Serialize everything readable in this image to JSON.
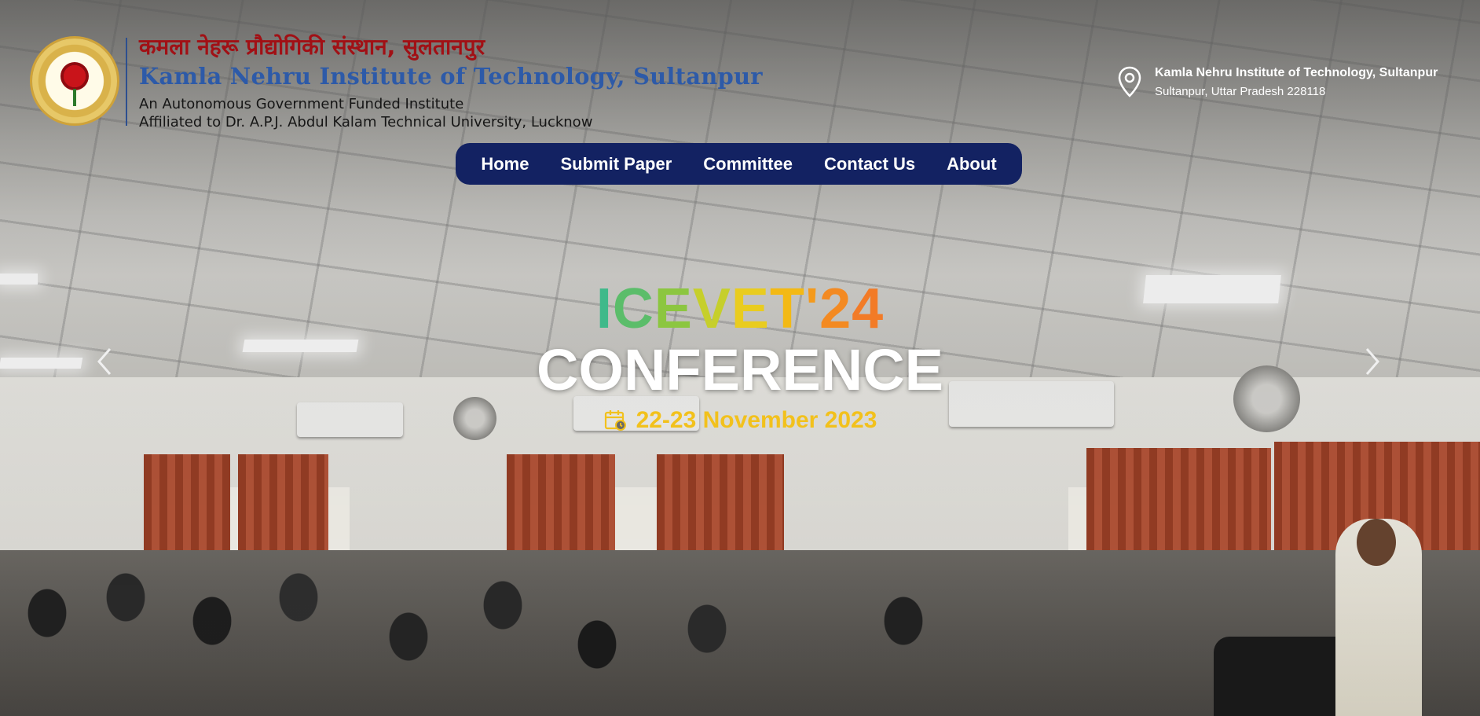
{
  "header": {
    "hindi_name": "कमला नेहरू प्रौद्योगिकी संस्थान, सुलतानपुर",
    "english_name": "Kamla Nehru Institute of Technology, Sultanpur",
    "tagline_line1": "An Autonomous Government Funded Institute",
    "tagline_line2": "Affiliated to Dr. A.P.J. Abdul Kalam Technical University, Lucknow",
    "logo_icon": "institute-logo",
    "address": {
      "title": "Kamla Nehru Institute of Technology, Sultanpur",
      "line": "Sultanpur, Uttar Pradesh 228118",
      "icon": "location-pin-icon"
    }
  },
  "nav": {
    "items": [
      {
        "label": "Home"
      },
      {
        "label": "Submit Paper"
      },
      {
        "label": "Committee"
      },
      {
        "label": "Contact Us"
      },
      {
        "label": "About"
      }
    ]
  },
  "hero": {
    "code_letters": [
      {
        "ch": "I",
        "color": "#3fb98a"
      },
      {
        "ch": "C",
        "color": "#5bbd6a"
      },
      {
        "ch": "E",
        "color": "#8cc640"
      },
      {
        "ch": "V",
        "color": "#c6cf2b"
      },
      {
        "ch": "E",
        "color": "#e9cc1f"
      },
      {
        "ch": "T",
        "color": "#f3b915"
      },
      {
        "ch": "'",
        "color": "#f49a1c"
      },
      {
        "ch": "2",
        "color": "#f38a22"
      },
      {
        "ch": "4",
        "color": "#f27b27"
      }
    ],
    "title": "CONFERENCE",
    "date": "22-23 November 2023",
    "date_icon": "calendar-icon",
    "date_color": "#f2c11c"
  },
  "carousel": {
    "prev_icon": "chevron-left-icon",
    "next_icon": "chevron-right-icon"
  },
  "colors": {
    "nav_bg": "#132262",
    "hindi_name": "#a11015",
    "english_name": "#2d5aa8"
  }
}
